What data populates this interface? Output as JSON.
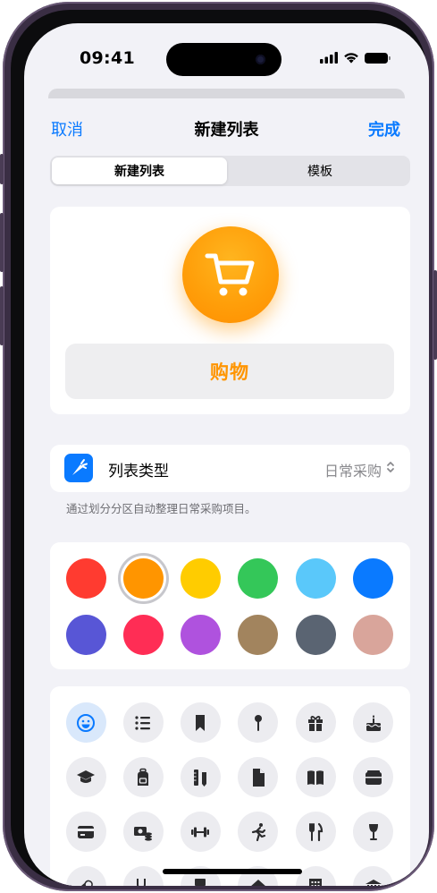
{
  "status_bar": {
    "time": "09:41"
  },
  "nav": {
    "cancel_label": "取消",
    "title": "新建列表",
    "done_label": "完成"
  },
  "segments": [
    {
      "label": "新建列表",
      "active": true
    },
    {
      "label": "模板",
      "active": false
    }
  ],
  "list": {
    "name": "购物",
    "icon": "cart-icon",
    "color": "#ff9500"
  },
  "list_type": {
    "label": "列表类型",
    "value": "日常采购",
    "icon": "carrot-icon",
    "footnote": "通过划分分区自动整理日常采购项目。"
  },
  "colors": {
    "selected_index": 1,
    "swatches": [
      "#ff3b30",
      "#ff9500",
      "#ffcc00",
      "#34c759",
      "#5ac8fa",
      "#0a7aff",
      "#5856d6",
      "#ff2d55",
      "#af52de",
      "#a2845e",
      "#5a6472",
      "#d9a59b"
    ]
  },
  "glyphs": {
    "selected_index": 0,
    "items": [
      "smiley-icon",
      "list-bullet-icon",
      "bookmark-icon",
      "pin-icon",
      "gift-icon",
      "birthday-cake-icon",
      "graduation-cap-icon",
      "backpack-icon",
      "ruler-pencil-icon",
      "document-icon",
      "book-icon",
      "wallet-icon",
      "credit-card-icon",
      "money-icon",
      "dumbbell-icon",
      "runner-icon",
      "fork-knife-icon",
      "wine-glass-icon",
      "pills-icon",
      "stethoscope-icon",
      "chair-icon",
      "house-icon",
      "building-icon",
      "bank-icon"
    ]
  }
}
